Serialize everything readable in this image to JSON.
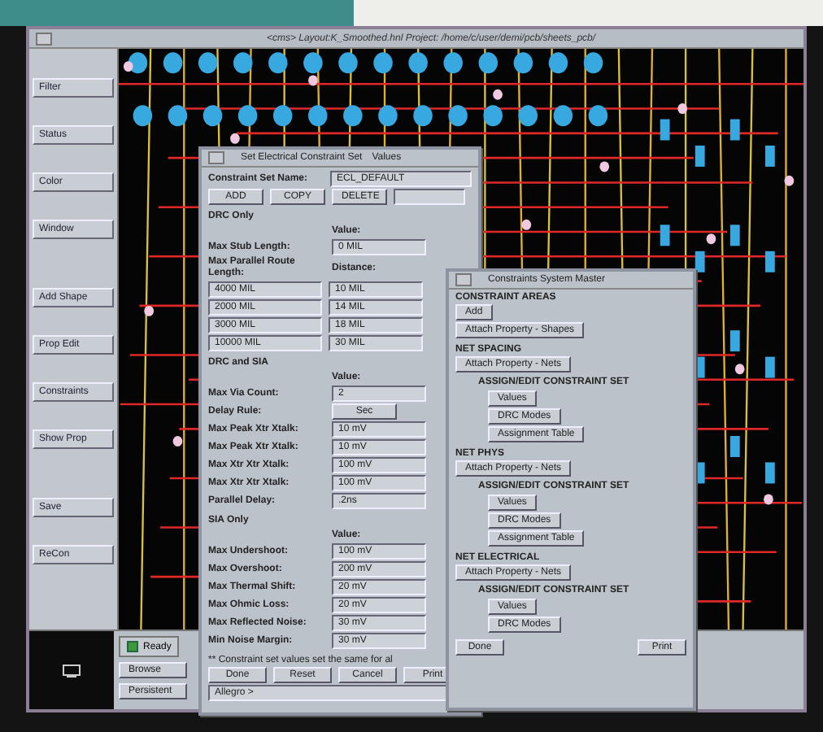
{
  "window": {
    "title": "<cms> Layout:K_Smoothed.hnl  Project: /home/c/user/demi/pcb/sheets_pcb/"
  },
  "sidebar": {
    "groups": [
      [
        "Filter",
        "Status",
        "Color",
        "Window"
      ],
      [
        "Add Shape",
        "Prop Edit",
        "Constraints",
        "Show Prop"
      ],
      [
        "Save",
        "ReCon"
      ]
    ]
  },
  "set_dialog": {
    "title": "Set Electrical Constraint Set",
    "title_suffix": "Values",
    "name_label": "Constraint Set Name:",
    "name_value": "ECL_DEFAULT",
    "actions": [
      "ADD",
      "COPY",
      "DELETE"
    ],
    "drc_only": {
      "heading": "DRC Only",
      "value_heading": "Value:",
      "stub_label": "Max Stub Length:",
      "stub_value": "0 MIL",
      "parallel_label": "Max Parallel Route Length:",
      "distance_heading": "Distance:",
      "rows": [
        {
          "length": "4000 MIL",
          "distance": "10 MIL"
        },
        {
          "length": "2000 MIL",
          "distance": "14 MIL"
        },
        {
          "length": "3000 MIL",
          "distance": "18 MIL"
        },
        {
          "length": "10000 MIL",
          "distance": "30 MIL"
        }
      ]
    },
    "drc_sia": {
      "heading": "DRC and SIA",
      "value_heading": "Value:",
      "rows": [
        {
          "label": "Max Via Count:",
          "value": "2",
          "kind": "field"
        },
        {
          "label": "Delay Rule:",
          "value": "Sec",
          "kind": "menu"
        },
        {
          "label": "Max Peak Xtr Xtalk:",
          "value": "10 mV",
          "kind": "field"
        },
        {
          "label": "Max Peak Xtr Xtalk:",
          "value": "10 mV",
          "kind": "field"
        },
        {
          "label": "Max Xtr Xtr Xtalk:",
          "value": "100 mV",
          "kind": "field"
        },
        {
          "label": "Max Xtr Xtr Xtalk:",
          "value": "100 mV",
          "kind": "field"
        },
        {
          "label": "Parallel Delay:",
          "value": ".2ns",
          "kind": "field"
        }
      ]
    },
    "sia_only": {
      "heading": "SIA Only",
      "value_heading": "Value:",
      "rows": [
        {
          "label": "Max Undershoot:",
          "value": "100 mV",
          "kind": "field"
        },
        {
          "label": "Max Overshoot:",
          "value": "200 mV",
          "kind": "field"
        },
        {
          "label": "Max Thermal Shift:",
          "value": "20 mV",
          "kind": "field"
        },
        {
          "label": "Max Ohmic Loss:",
          "value": "20 mV",
          "kind": "field"
        },
        {
          "label": "Max Reflected Noise:",
          "value": "30 mV",
          "kind": "field"
        },
        {
          "label": "Min Noise Margin:",
          "value": "30 mV",
          "kind": "field"
        }
      ]
    },
    "message": "** Constraint set values set the same for al",
    "buttons": [
      "Done",
      "Reset",
      "Cancel",
      "Print"
    ]
  },
  "master_dialog": {
    "title": "Constraints System Master",
    "groups": [
      {
        "heading": "CONSTRAINT AREAS",
        "buttons": [
          "Add",
          "Attach Property - Shapes"
        ]
      },
      {
        "heading": "NET SPACING",
        "buttons": [
          "Attach Property - Nets"
        ],
        "sub_heading": "ASSIGN/EDIT CONSTRAINT SET",
        "sub_buttons": [
          "Values",
          "DRC Modes",
          "Assignment Table"
        ]
      },
      {
        "heading": "NET PHYS",
        "buttons": [
          "Attach Property - Nets"
        ],
        "sub_heading": "ASSIGN/EDIT CONSTRAINT SET",
        "sub_buttons": [
          "Values",
          "DRC Modes",
          "Assignment Table"
        ]
      },
      {
        "heading": "NET ELECTRICAL",
        "buttons": [
          "Attach Property - Nets"
        ],
        "sub_heading": "ASSIGN/EDIT CONSTRAINT SET",
        "sub_buttons": [
          "Values",
          "DRC Modes"
        ]
      }
    ],
    "buttons": [
      "Done",
      "Print"
    ]
  },
  "status": {
    "indicator": "Ready",
    "left_buttons": [
      "Browse",
      "Persistent"
    ],
    "command": "Allegro > "
  }
}
